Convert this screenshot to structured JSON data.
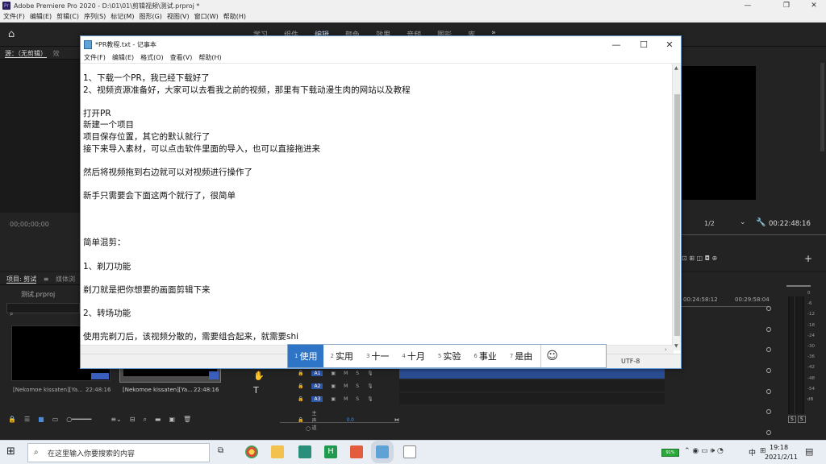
{
  "app": {
    "title": "Adobe Premiere Pro 2020 - D:\\01\\01\\剪辑视频\\测试.prproj *",
    "logo": "Pr",
    "menu": [
      "文件(F)",
      "编辑(E)",
      "剪辑(C)",
      "序列(S)",
      "标记(M)",
      "图形(G)",
      "视图(V)",
      "窗口(W)",
      "帮助(H)"
    ],
    "workspaces": [
      "学习",
      "组件",
      "编辑",
      "颜色",
      "效果",
      "音频",
      "图形",
      "库"
    ],
    "active_workspace": "编辑",
    "more": "»",
    "source_tab": "源：（无剪辑）",
    "source_tab_extra": "效",
    "source_timecode": "00;00;00;00",
    "program_scale": "1/2",
    "program_timecode": "00:22:48:16",
    "project_tab": "项目: 剪试",
    "project_tab2": "媒体浏",
    "project_file": "测试.prproj",
    "clips": [
      {
        "name": "[Nekomoe kissaten][Ya...",
        "duration": "22:48:16"
      },
      {
        "name": "[Nekomoe kissaten][Ya...",
        "duration": "22:48:16"
      }
    ],
    "timeline_times": [
      "00:24:58:12",
      "00:29:58:04"
    ],
    "tracks": [
      "A1",
      "A2",
      "A3"
    ],
    "master_label": "主声道",
    "master_value": "0.0",
    "meter_labels": [
      "0",
      "-6",
      "-12",
      "-18",
      "-24",
      "-30",
      "-36",
      "-42",
      "-48",
      "-54",
      "dB"
    ],
    "meter_solo": [
      "S",
      "S"
    ]
  },
  "notepad": {
    "title": "*PR教程.txt - 记事本",
    "menu": [
      "文件(F)",
      "编辑(E)",
      "格式(O)",
      "查看(V)",
      "帮助(H)"
    ],
    "lines": [
      "1、下载一个PR，我已经下载好了",
      "2、视频资源准备好，大家可以去看我之前的视频，那里有下载动漫生肉的网站以及教程",
      "",
      "打开PR",
      "新建一个项目",
      "项目保存位置，其它的默认就行了",
      "接下来导入素材，可以点击软件里面的导入，也可以直接拖进来",
      "",
      "然后将视频拖到右边就可以对视频进行操作了",
      "",
      "新手只需要会下面这两个就行了，很简单",
      "",
      "",
      "",
      "简单混剪：",
      "",
      "1、剃刀功能",
      "",
      "剃刀就是把你想要的画面剪辑下来",
      "",
      "2、转场功能",
      "",
      "使用完剃刀后，该视频分散的，需要组合起来，就需要shi"
    ],
    "encoding": "UTF-8",
    "controls": {
      "min": "—",
      "max": "☐",
      "close": "✕"
    }
  },
  "ime": {
    "candidates": [
      {
        "n": "1",
        "text": "使用"
      },
      {
        "n": "2",
        "text": "实用"
      },
      {
        "n": "3",
        "text": "十一"
      },
      {
        "n": "4",
        "text": "十月"
      },
      {
        "n": "5",
        "text": "实验"
      },
      {
        "n": "6",
        "text": "事业"
      },
      {
        "n": "7",
        "text": "是由"
      }
    ],
    "emoji": "☺"
  },
  "taskbar": {
    "search_placeholder": "在这里输入你要搜索的内容",
    "time": "19:18",
    "date": "2021/2/11",
    "lang": "中",
    "battery": "91%"
  }
}
